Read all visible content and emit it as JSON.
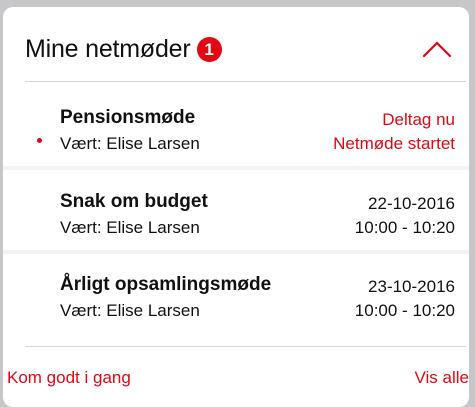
{
  "header": {
    "title": "Mine netmøder",
    "badge_count": "1",
    "collapse_icon": "chevron-up-icon"
  },
  "meetings": [
    {
      "name": "Pensionsmøde",
      "host": "Vært: Elise Larsen",
      "line1": "Deltag nu",
      "line2": "Netmøde startet",
      "active": true
    },
    {
      "name": "Snak om budget",
      "host": "Vært: Elise Larsen",
      "line1": "22-10-2016",
      "line2": "10:00 - 10:20",
      "active": false
    },
    {
      "name": "Årligt opsamlingsmøde",
      "host": "Vært: Elise Larsen",
      "line1": "23-10-2016",
      "line2": "10:00 - 10:20",
      "active": false
    }
  ],
  "footer": {
    "left_link": "Kom godt i gang",
    "right_link": "Vis alle"
  },
  "colors": {
    "accent": "#e30613",
    "background": "#c7c7c9",
    "card": "#ffffff"
  }
}
